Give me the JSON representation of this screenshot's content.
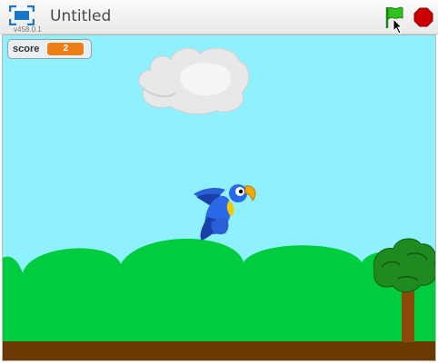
{
  "header": {
    "title": "Untitled",
    "version": "v458.0.1",
    "fullscreen_icon": "fullscreen-icon",
    "flag_icon": "green-flag-icon",
    "stop_icon": "stop-icon"
  },
  "stage": {
    "monitor": {
      "label": "score",
      "value": "2"
    },
    "sprites": [
      "cloud",
      "parrot",
      "tree"
    ]
  },
  "colors": {
    "sky": "#8ff0fe",
    "hills": "#00cc3f",
    "ground": "#6b3a00",
    "monitor_value": "#ee7d16",
    "stop": "#cc0000",
    "flag": "#2fc41d"
  }
}
